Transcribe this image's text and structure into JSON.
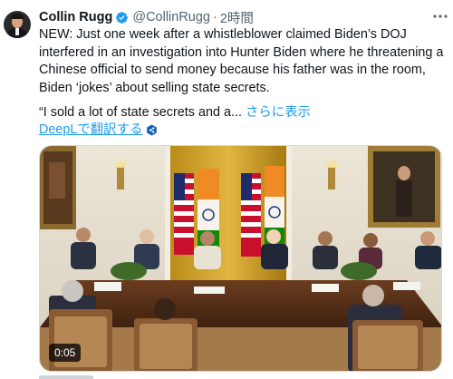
{
  "author": {
    "display_name": "Collin Rugg",
    "handle": "@CollinRugg",
    "separator": "·",
    "time": "2時間",
    "verified": true
  },
  "tweet": {
    "text": "NEW: Just one week after a whistleblower claimed Biden’s DOJ interfered in an investigation into Hunter Biden where he threatening a Chinese official to send money because his father was in the room, Biden ‘jokes’ about selling state secrets.",
    "quote": "“I sold a lot of state secrets and a...",
    "show_more_label": "さらに表示",
    "translate_label": "DeepLで翻訳する"
  },
  "media": {
    "type": "video",
    "duration": "0:05"
  },
  "icons": {
    "more": "more-options-icon",
    "verified": "verified-badge-icon",
    "deepl": "deepl-icon"
  },
  "colors": {
    "link": "#1d9bf0",
    "secondary_text": "#536471",
    "primary_text": "#0f1419"
  }
}
